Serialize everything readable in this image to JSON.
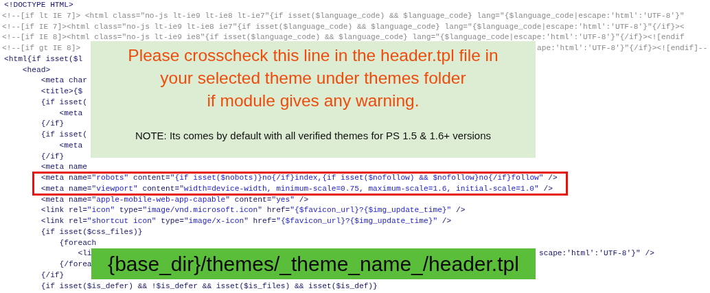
{
  "code_lines": [
    {
      "kind": "code",
      "text": "<!DOCTYPE HTML>"
    },
    {
      "kind": "comment",
      "text": "<!--[if lt IE 7]> <html class=\"no-js lt-ie9 lt-ie8 lt-ie7\"{if isset($language_code) && $language_code} lang=\"{$language_code|escape:'html':'UTF-8'}\""
    },
    {
      "kind": "comment",
      "text": "<!--[if IE 7]><html class=\"no-js lt-ie9 lt-ie8 ie7\"{if isset($language_code) && $language_code} lang=\"{$language_code|escape:'html':'UTF-8'}\"{/if}><"
    },
    {
      "kind": "comment",
      "text": "<!--[if IE 8]><html class=\"no-js lt-ie9 ie8\"{if isset($language_code) && $language_code} lang=\"{$language_code|escape:'html':'UTF-8'}\"{/if}><![endif"
    },
    {
      "kind": "comment",
      "text": "<!--[if gt IE 8]>",
      "text_right": "ape:'html':'UTF-8'}\"{/if}><![endif]--"
    },
    {
      "kind": "code",
      "text": "<html{if isset($l"
    },
    {
      "kind": "code",
      "text": "    <head>"
    },
    {
      "kind": "code",
      "text": "        <meta char"
    },
    {
      "kind": "code",
      "text": "        <title>{$"
    },
    {
      "kind": "code",
      "text": "        {if isset("
    },
    {
      "kind": "code",
      "text": "            <meta"
    },
    {
      "kind": "code",
      "text": "        {/if}"
    },
    {
      "kind": "code",
      "text": "        {if isset("
    },
    {
      "kind": "code",
      "text": "            <meta"
    },
    {
      "kind": "code",
      "text": "        {/if}"
    },
    {
      "kind": "code",
      "text": "        <meta name"
    },
    {
      "kind": "code",
      "text": "        <meta name=\"robots\" content=\"{if isset($nobots)}no{/if}index,{if isset($nofollow) && $nofollow}no{/if}follow\" />"
    },
    {
      "kind": "code",
      "text": "        <meta name=\"viewport\" content=\"width=device-width, minimum-scale=0.75, maximum-scale=1.6, initial-scale=1.0\" />"
    },
    {
      "kind": "code",
      "text": "        <meta name=\"apple-mobile-web-app-capable\" content=\"yes\" />"
    },
    {
      "kind": "code",
      "text": "        <link rel=\"icon\" type=\"image/vnd.microsoft.icon\" href=\"{$favicon_url}?{$img_update_time}\" />"
    },
    {
      "kind": "code",
      "text": "        <link rel=\"shortcut icon\" type=\"image/x-icon\" href=\"{$favicon_url}?{$img_update_time}\" />"
    },
    {
      "kind": "code",
      "text": "        {if isset($css_files)}"
    },
    {
      "kind": "code",
      "text": "            {foreach"
    },
    {
      "kind": "code",
      "text": "                <li",
      "text_right": "scape:'html':'UTF-8'}\" />"
    },
    {
      "kind": "code",
      "text": "            {/forea"
    },
    {
      "kind": "code",
      "text": "        {/if}"
    },
    {
      "kind": "code",
      "text": "        {if isset($is_defer) && !$is_defer && isset($is_files) && isset($is_def)}"
    }
  ],
  "note": {
    "message_lines": [
      "Please crosscheck this line in the header.tpl file in",
      "your selected theme under themes folder",
      "if module gives any warning."
    ],
    "footnote": "NOTE: Its comes by default with all verified themes for PS 1.5 & 1.6+ versions"
  },
  "path_label": "{base_dir}/themes/_theme_name_/header.tpl"
}
